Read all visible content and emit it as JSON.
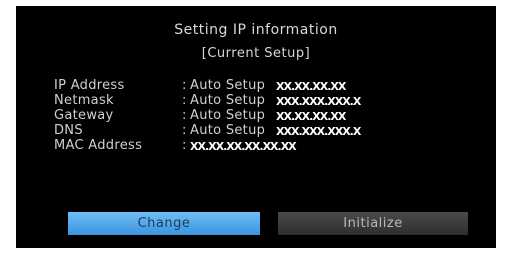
{
  "screen": {
    "title": "Setting IP information",
    "subtitle": "[Current Setup]"
  },
  "info": {
    "rows": [
      {
        "label": "IP Address",
        "separator": ":",
        "mode": "Auto Setup",
        "value": "XX.XX.XX.XX"
      },
      {
        "label": "Netmask",
        "separator": ":",
        "mode": "Auto Setup",
        "value": "XXX.XXX.XXX.X"
      },
      {
        "label": "Gateway",
        "separator": ":",
        "mode": "Auto Setup",
        "value": "XX.XX.XX.XX"
      },
      {
        "label": "DNS",
        "separator": ":",
        "mode": "Auto Setup",
        "value": "XXX.XXX.XXX.X"
      }
    ],
    "mac": {
      "label": "MAC Address",
      "separator": ":",
      "value": "XX.XX.XX.XX.XX.XX"
    }
  },
  "buttons": {
    "change_label": "Change",
    "initialize_label": "Initialize",
    "selected": "Change"
  },
  "colors": {
    "background": "#000000",
    "text": "#d0d0d0",
    "selected_button": "#4ea6e8",
    "inactive_button": "#3a3a3a"
  }
}
